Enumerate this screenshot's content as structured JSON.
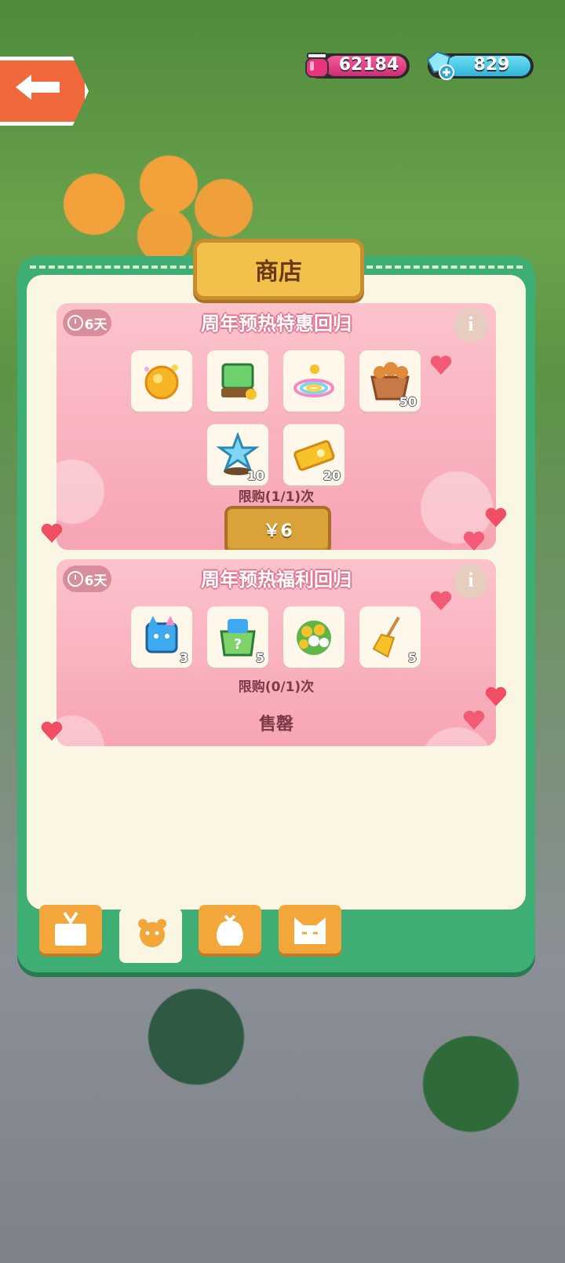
{
  "resources": {
    "gems": "62184",
    "crystals": "829"
  },
  "shop": {
    "title": "商店",
    "packs": [
      {
        "timer": "6天",
        "title": "周年预热特惠回归",
        "items": [
          {
            "icon": "gold-orb-icon",
            "count": ""
          },
          {
            "icon": "green-cube-chest-icon",
            "count": ""
          },
          {
            "icon": "rainbow-swirl-icon",
            "count": ""
          },
          {
            "icon": "cookie-basket-icon",
            "count": "50"
          },
          {
            "icon": "blue-star-plant-icon",
            "count": "10"
          },
          {
            "icon": "gold-ticket-icon",
            "count": "20"
          }
        ],
        "limit": "限购(1/1)次",
        "price": "￥6"
      },
      {
        "timer": "6天",
        "title": "周年预热福利回归",
        "items": [
          {
            "icon": "blue-cat-box-icon",
            "count": "3"
          },
          {
            "icon": "mystery-bag-icon",
            "count": "5"
          },
          {
            "icon": "flower-bouquet-icon",
            "count": ""
          },
          {
            "icon": "broom-icon",
            "count": "5"
          }
        ],
        "limit": "限购(0/1)次",
        "status": "售罄"
      }
    ],
    "tabs": [
      "gift-box-tab-icon",
      "bear-face-tab-icon",
      "money-bag-tab-icon",
      "cat-face-tab-icon"
    ]
  },
  "colors": {
    "panel_green": "#3fae74",
    "card_pink": "#f7a4b3",
    "price_gold": "#d9a33a"
  }
}
